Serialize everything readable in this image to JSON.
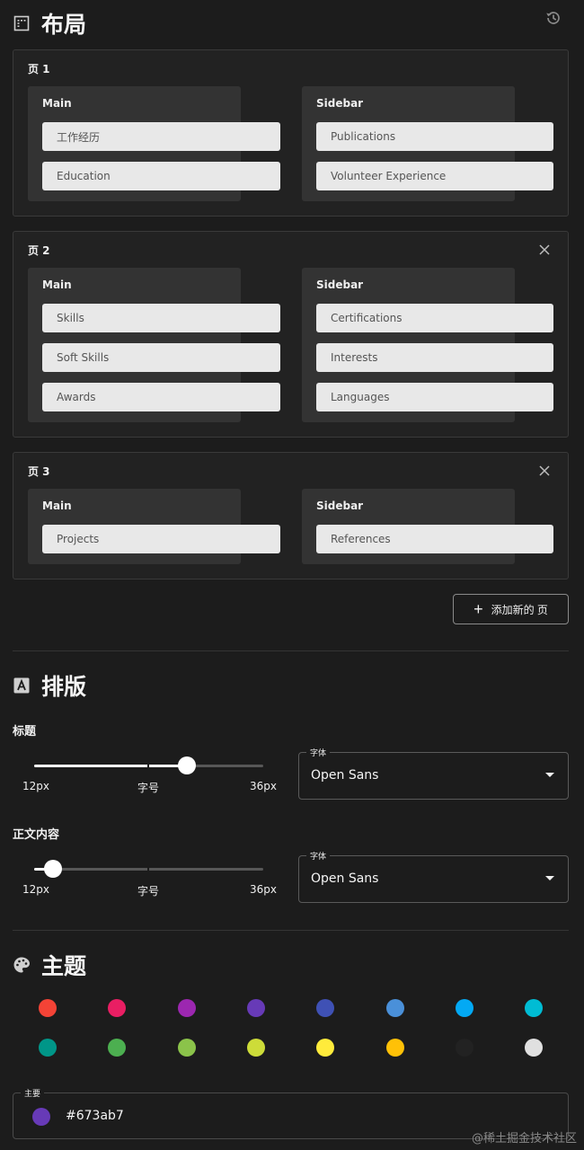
{
  "layout": {
    "title": "布局",
    "pages": [
      {
        "label": "页 1",
        "closable": false,
        "main": {
          "title": "Main",
          "items": [
            "工作经历",
            "Education"
          ]
        },
        "sidebar": {
          "title": "Sidebar",
          "items": [
            "Publications",
            "Volunteer Experience"
          ]
        }
      },
      {
        "label": "页 2",
        "closable": true,
        "main": {
          "title": "Main",
          "items": [
            "Skills",
            "Soft Skills",
            "Awards"
          ]
        },
        "sidebar": {
          "title": "Sidebar",
          "items": [
            "Certifications",
            "Interests",
            "Languages"
          ]
        }
      },
      {
        "label": "页 3",
        "closable": true,
        "main": {
          "title": "Main",
          "items": [
            "Projects"
          ]
        },
        "sidebar": {
          "title": "Sidebar",
          "items": [
            "References"
          ]
        }
      }
    ],
    "add_page_label": "添加新的 页"
  },
  "typography": {
    "title": "排版",
    "heading": {
      "label": "标题",
      "slider": {
        "min_label": "12px",
        "mid_label": "字号",
        "max_label": "36px",
        "min": 12,
        "max": 36,
        "value": 28
      },
      "font": {
        "legend": "字体",
        "value": "Open Sans"
      }
    },
    "body": {
      "label": "正文内容",
      "slider": {
        "min_label": "12px",
        "mid_label": "字号",
        "max_label": "36px",
        "min": 12,
        "max": 36,
        "value": 14
      },
      "font": {
        "legend": "字体",
        "value": "Open Sans"
      }
    }
  },
  "theme": {
    "title": "主题",
    "swatches": [
      "#f44336",
      "#e91e63",
      "#9c27b0",
      "#673ab7",
      "#3f51b5",
      "#4a90d9",
      "#03a9f4",
      "#00bcd4",
      "#009688",
      "#4caf50",
      "#8bc34a",
      "#cddc39",
      "#ffeb3b",
      "#ffc107",
      "#222222",
      "#e0e0e0"
    ],
    "primary": {
      "legend": "主要",
      "value": "#673ab7",
      "color": "#673ab7"
    }
  },
  "watermark": "@稀土掘金技术社区"
}
